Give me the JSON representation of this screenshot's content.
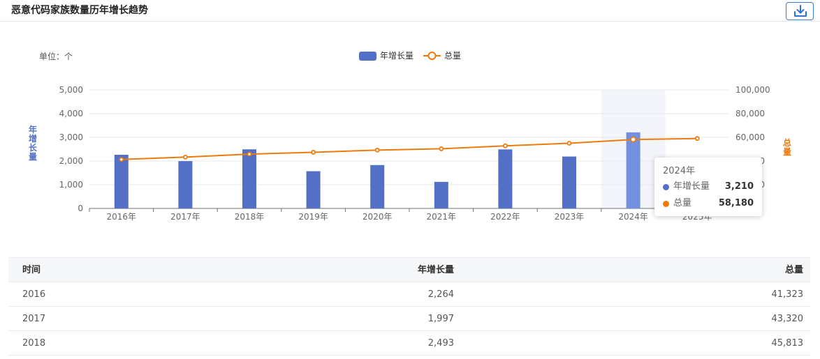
{
  "header": {
    "title": "恶意代码家族数量历年增长趋势"
  },
  "chart_data": {
    "type": "bar",
    "unit_label": "单位：个",
    "categories": [
      "2016年",
      "2017年",
      "2018年",
      "2019年",
      "2020年",
      "2021年",
      "2022年",
      "2023年",
      "2024年",
      "2025年"
    ],
    "series": [
      {
        "name": "年增长量",
        "type": "bar",
        "axis": "left",
        "color": "#5470c6",
        "values": [
          2264,
          1997,
          2493,
          1570,
          1830,
          1120,
          2490,
          2190,
          3210,
          null
        ]
      },
      {
        "name": "总量",
        "type": "line",
        "axis": "right",
        "color": "#ee7a0c",
        "values": [
          41323,
          43320,
          45813,
          47383,
          49213,
          50333,
          52823,
          55013,
          58180,
          59000
        ]
      }
    ],
    "yleft": {
      "label": "年增长量",
      "ylim": [
        0,
        5000
      ],
      "ticks": [
        "0",
        "1,000",
        "2,000",
        "3,000",
        "4,000",
        "5,000"
      ]
    },
    "yright": {
      "label": "总量",
      "ylim": [
        0,
        100000
      ],
      "ticks": [
        "0",
        "20,000",
        "40,000",
        "60,000",
        "80,000",
        "100,000"
      ]
    },
    "highlight_category": "2024年",
    "tooltip": {
      "title": "2024年",
      "rows": [
        {
          "name": "年增长量",
          "value": "3,210",
          "color": "#5470c6"
        },
        {
          "name": "总量",
          "value": "58,180",
          "color": "#ee7a0c"
        }
      ]
    },
    "legend": [
      "年增长量",
      "总量"
    ]
  },
  "table": {
    "headers": [
      "时间",
      "年增长量",
      "总量"
    ],
    "rows": [
      [
        "2016",
        "2,264",
        "41,323"
      ],
      [
        "2017",
        "1,997",
        "43,320"
      ],
      [
        "2018",
        "2,493",
        "45,813"
      ]
    ]
  }
}
